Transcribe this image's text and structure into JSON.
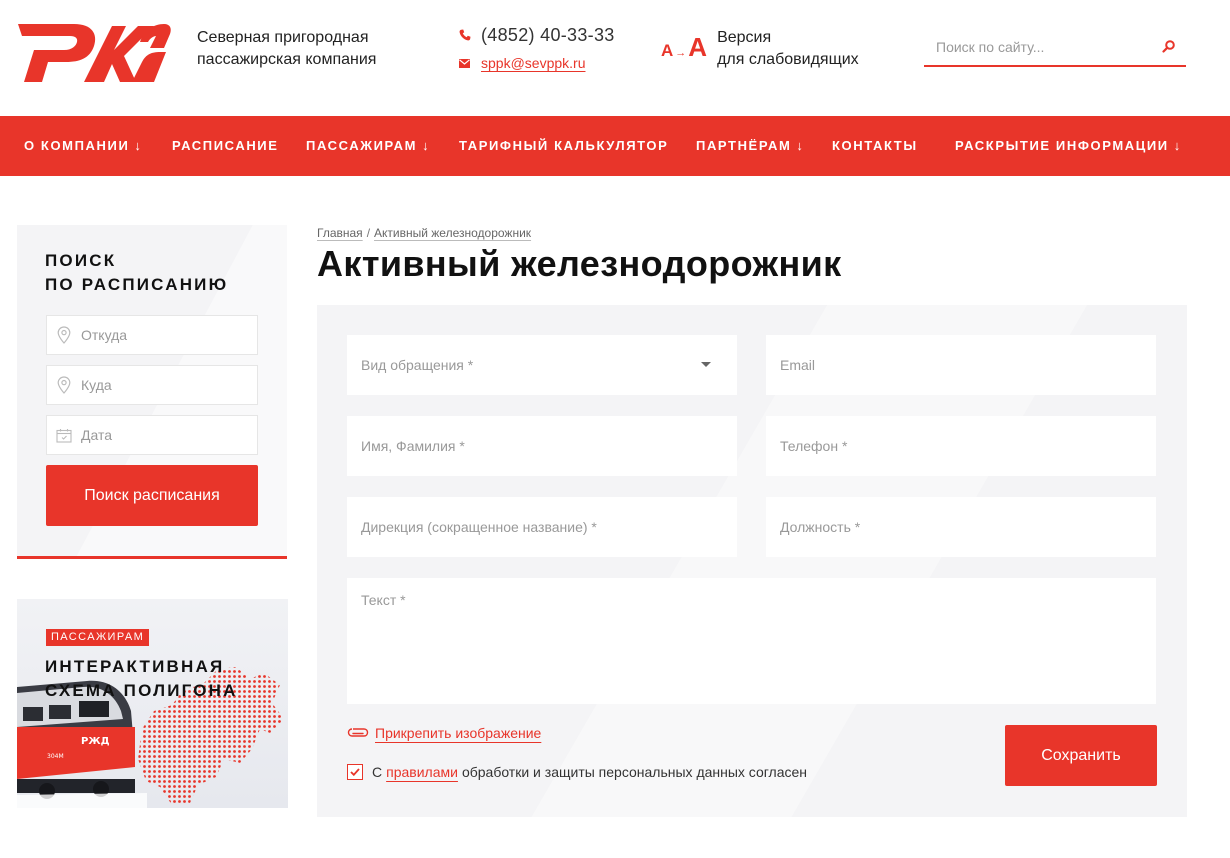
{
  "header": {
    "logo_label": "РЖД",
    "company_line1": "Северная пригородная",
    "company_line2": "пассажирская компания",
    "phone": "(4852) 40-33-33",
    "email": "sppk@sevppk.ru",
    "vision_small": "A",
    "vision_arrow": "→",
    "vision_big": "A",
    "vision_line1": "Версия",
    "vision_line2": "для слабовидящих",
    "search_placeholder": "Поиск по сайту...",
    "accent_color": "#e8352a"
  },
  "nav": {
    "items": [
      {
        "label": "О компании",
        "chevron": "↓"
      },
      {
        "label": "Расписание",
        "chevron": ""
      },
      {
        "label": "Пассажирам",
        "chevron": "↓"
      },
      {
        "label": "Тарифный калькулятор",
        "chevron": ""
      },
      {
        "label": "Партнёрам",
        "chevron": "↓"
      },
      {
        "label": "Контакты",
        "chevron": ""
      },
      {
        "label": "Раскрытие информации",
        "chevron": "↓"
      }
    ]
  },
  "sidebar": {
    "title_line1": "ПОИСК",
    "title_line2": "ПО РАСПИСАНИЮ",
    "from_placeholder": "Откуда",
    "to_placeholder": "Куда",
    "date_placeholder": "Дата",
    "button_label": "Поиск расписания"
  },
  "banner": {
    "tag": "ПАССАЖИРАМ",
    "title_line1": "ИНТЕРАКТИВНАЯ",
    "title_line2": "СХЕМА ПОЛИГОНА",
    "train_logo": "РЖД",
    "train_number": "304М"
  },
  "breadcrumb": {
    "home": "Главная",
    "separator": "/",
    "current": "Активный железнодорожник"
  },
  "page_title": "Активный железнодорожник",
  "form": {
    "type_placeholder": "Вид обращения *",
    "email_placeholder": "Email",
    "name_placeholder": "Имя, Фамилия *",
    "phone_placeholder": "Телефон *",
    "direction_placeholder": "Дирекция (сокращенное название) *",
    "position_placeholder": "Должность *",
    "text_placeholder": "Текст *",
    "attach_label": "Прикрепить изображение",
    "agree_prefix": "С",
    "agree_link": "правилами",
    "agree_suffix": "обработки и защиты персональных данных согласен",
    "agree_checked": true,
    "save_label": "Сохранить"
  }
}
